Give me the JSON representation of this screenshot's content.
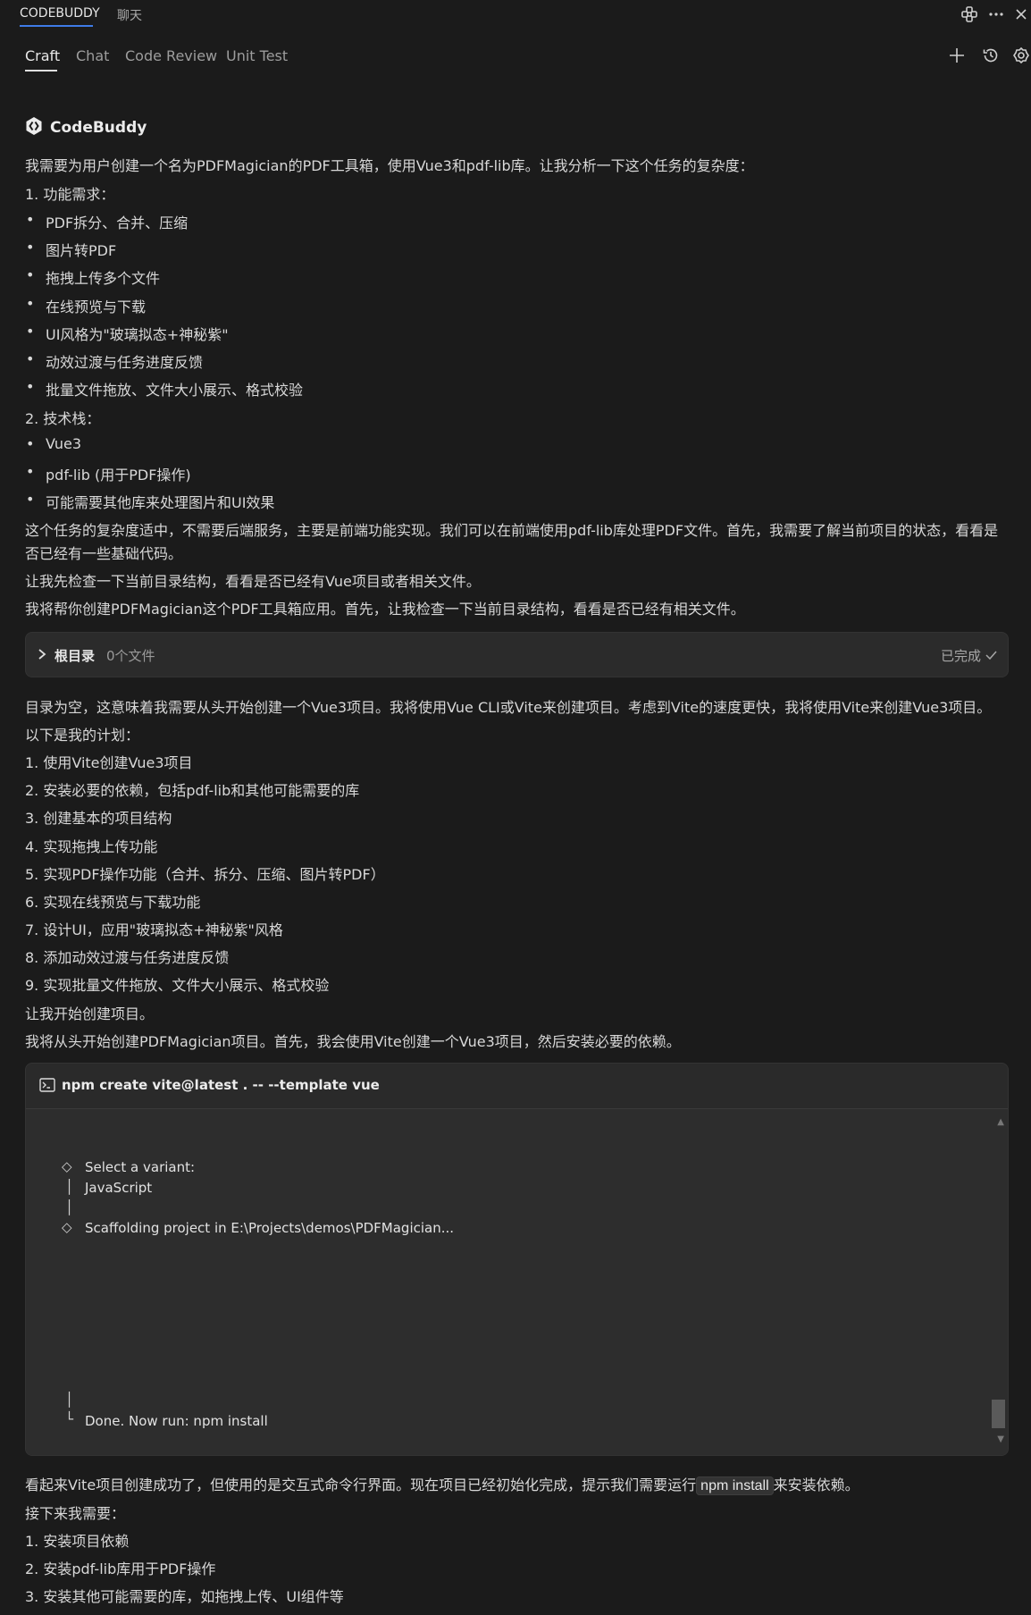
{
  "top_tabs": [
    "CODEBUDDY",
    "聊天"
  ],
  "sub_tabs": [
    "Craft",
    "Chat",
    "Code Review",
    "Unit Test"
  ],
  "brand": "CodeBuddy",
  "intro": "我需要为用户创建一个名为PDFMagician的PDF工具箱，使用Vue3和pdf-lib库。让我分析一下这个任务的复杂度：",
  "section1_title": "1. 功能需求：",
  "features": [
    "PDF拆分、合并、压缩",
    "图片转PDF",
    "拖拽上传多个文件",
    "在线预览与下载",
    "UI风格为\"玻璃拟态+神秘紫\"",
    "动效过渡与任务进度反馈",
    "批量文件拖放、文件大小展示、格式校验"
  ],
  "section2_title": "2. 技术栈：",
  "stack": [
    "Vue3",
    "pdf-lib (用于PDF操作)",
    "可能需要其他库来处理图片和UI效果"
  ],
  "complexity_line1": "这个任务的复杂度适中，不需要后端服务，主要是前端功能实现。我们可以在前端使用pdf-lib库处理PDF文件。首先，我需要了解当前项目的状态，看看是",
  "complexity_line2": "否已经有一些基础代码。",
  "check_line": "让我先检查一下当前目录结构，看看是否已经有Vue项目或者相关文件。",
  "help_line": "我将帮你创建PDFMagician这个PDF工具箱应用。首先，让我检查一下当前目录结构，看看是否已经有相关文件。",
  "dir_card": {
    "title": "根目录",
    "count": "0个文件",
    "status": "已完成"
  },
  "empty_line": "目录为空，这意味着我需要从头开始创建一个Vue3项目。我将使用Vue CLI或Vite来创建项目。考虑到Vite的速度更快，我将使用Vite来创建Vue3项目。",
  "plan_title": "以下是我的计划：",
  "plan": [
    "1. 使用Vite创建Vue3项目",
    "2. 安装必要的依赖，包括pdf-lib和其他可能需要的库",
    "3. 创建基本的项目结构",
    "4. 实现拖拽上传功能",
    "5. 实现PDF操作功能（合并、拆分、压缩、图片转PDF）",
    "6. 实现在线预览与下载功能",
    "7. 设计UI，应用\"玻璃拟态+神秘紫\"风格",
    "8. 添加动效过渡与任务进度反馈",
    "9. 实现批量文件拖放、文件大小展示、格式校验"
  ],
  "start_line": "让我开始创建项目。",
  "scratch_line": "我将从头开始创建PDFMagician项目。首先，我会使用Vite创建一个Vue3项目，然后安装必要的依赖。",
  "terminal": {
    "command": "npm create vite@latest . -- --template vue",
    "lines": [
      "Select a variant:",
      "JavaScript",
      "Scaffolding project in E:\\Projects\\demos\\PDFMagician...",
      "Done. Now run:  npm install"
    ]
  },
  "after_pre": "看起来Vite项目创建成功了，但使用的是交互式命令行界面。现在项目已经初始化完成，提示我们需要运行",
  "after_code": "npm install",
  "after_post": "来安装依赖。",
  "next_title": "接下来我需要：",
  "next_steps": [
    "1. 安装项目依赖",
    "2. 安装pdf-lib库用于PDF操作",
    "3. 安装其他可能需要的库，如拖拽上传、UI组件等"
  ],
  "colors": {
    "background": "#1b1b1b",
    "card": "#2b2b2b",
    "accent_tab": "#3e7be8"
  },
  "icons": [
    "extensions-icon",
    "more-icon",
    "close-icon",
    "add-icon",
    "history-icon",
    "settings-icon",
    "codebuddy-logo-icon",
    "chevron-right-icon",
    "check-icon",
    "terminal-icon",
    "diamond-icon"
  ]
}
